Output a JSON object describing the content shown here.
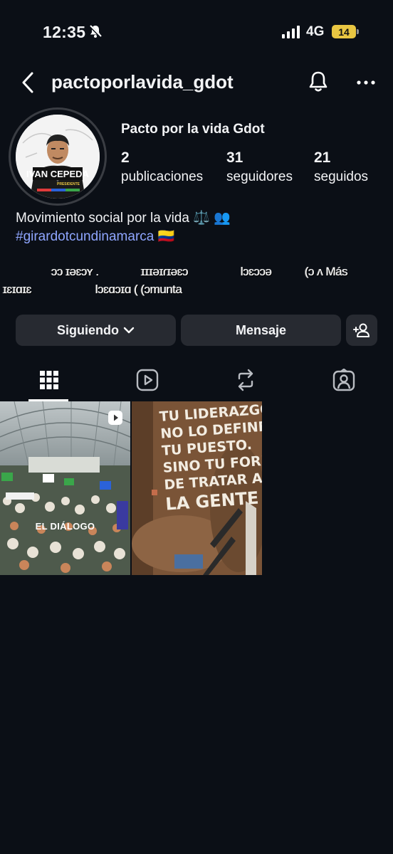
{
  "status_bar": {
    "time": "12:35",
    "network": "4G",
    "battery": "14"
  },
  "header": {
    "username": "pactoporlavida_gdot"
  },
  "profile": {
    "display_name": "Pacto por la vida Gdot",
    "avatar_label": "IVAN CEPEDA",
    "avatar_sublabel": "PRESIDENTE",
    "stats": [
      {
        "count": "2",
        "label": "publicaciones"
      },
      {
        "count": "31",
        "label": "seguidores"
      },
      {
        "count": "21",
        "label": "seguidos"
      }
    ],
    "bio_line1": "Movimiento social por la vida ⚖️ 👥",
    "bio_hashtag": "#girardotcundinamarca",
    "bio_flag": "🇨🇴",
    "mutuals_line1_parts": [
      "ɔɔ ɪəɛɔʏ .",
      "ɪɪɪəɪɾɪəɛɔ",
      "lɔɛɔɔə",
      "(ɔ ʌ Más"
    ],
    "mutuals_line2_parts": [
      "ɪɛɪɑɪɛ",
      "lɔɛɑɔɪɑ ( (ɔmunta"
    ]
  },
  "actions": {
    "following_label": "Siguiendo",
    "message_label": "Mensaje"
  },
  "tabs": [
    "grid-icon",
    "reels-icon",
    "reposts-icon",
    "tagged-icon"
  ],
  "posts": [
    {
      "caption": "EL DIÁLOGO",
      "type": "reel"
    },
    {
      "mural_lines": [
        "TU LIDERAZGO",
        "NO LO DEFINE",
        "TU PUESTO.",
        "SINO TU FORMA",
        "DE TRATAR A",
        "LA GENTE"
      ]
    }
  ]
}
